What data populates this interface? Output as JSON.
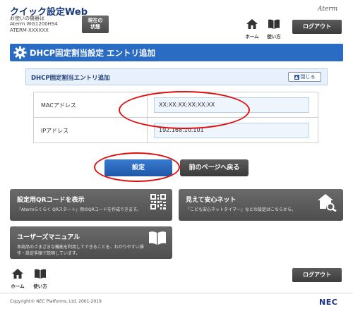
{
  "header": {
    "app_title": "クイック設定Web",
    "device_label": "お使いの機器は",
    "device_model": "Aterm WG1200HS4",
    "device_id": "ATERM-XXXXXX",
    "status_button": "現在の\n状態",
    "brand": "Aterm",
    "home_label": "ホーム",
    "manual_label": "使い方",
    "logout_label": "ログアウト"
  },
  "page": {
    "title": "DHCP固定割当設定 エントリ追加",
    "section_title": "DHCP固定割当エントリ追加",
    "close_label": "閉じる"
  },
  "form": {
    "fields": [
      {
        "label": "MACアドレス",
        "value": "XX:XX:XX:XX:XX:XX"
      },
      {
        "label": "IPアドレス",
        "value": "192.168.10.101"
      }
    ],
    "submit_label": "設定",
    "back_label": "前のページへ戻る"
  },
  "tiles": {
    "qr": {
      "title": "設定用QRコードを表示",
      "desc": "「Atermらくらく QRスタート」用のQRコードを作成できます。"
    },
    "safe": {
      "title": "見えて安心ネット",
      "desc": "「こども安心ネットタイマー」などの設定はこちらから。"
    },
    "manual": {
      "title": "ユーザーズマニュアル",
      "desc1": "本商品のさまざまな機能を利用してできることを、わかりやすい操",
      "desc2": "作・設定手順で説明しています。"
    }
  },
  "footer": {
    "home_label": "ホーム",
    "manual_label": "使い方",
    "logout_label": "ログアウト",
    "copyright": "Copyright© NEC Platforms, Ltd. 2001-2019",
    "logo": "NEC"
  },
  "colors": {
    "accent": "#2a6bc4",
    "annotation": "#e01010",
    "tile": "#5a5a5a"
  }
}
